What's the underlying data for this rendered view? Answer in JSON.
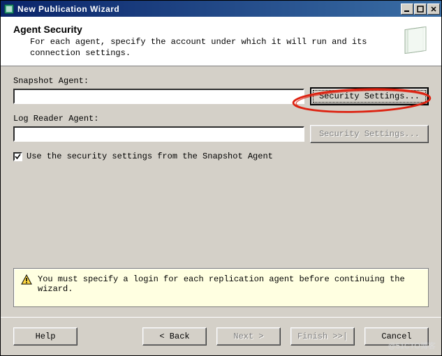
{
  "window": {
    "title": "New Publication Wizard"
  },
  "header": {
    "heading": "Agent Security",
    "description": "For each agent, specify the account under which it will run and its connection settings."
  },
  "snapshot": {
    "label": "Snapshot Agent:",
    "value": "",
    "button": "Security Settings..."
  },
  "logreader": {
    "label": "Log Reader Agent:",
    "value": "",
    "button": "Security Settings..."
  },
  "checkbox": {
    "checked": true,
    "label": "Use the security settings from the Snapshot Agent"
  },
  "warning": {
    "text": "You must specify a login for each replication agent before continuing the wizard."
  },
  "footer": {
    "help": "Help",
    "back": "< Back",
    "next": "Next >",
    "finish": "Finish >>|",
    "cancel": "Cancel"
  },
  "watermark": "@51CTO博客"
}
